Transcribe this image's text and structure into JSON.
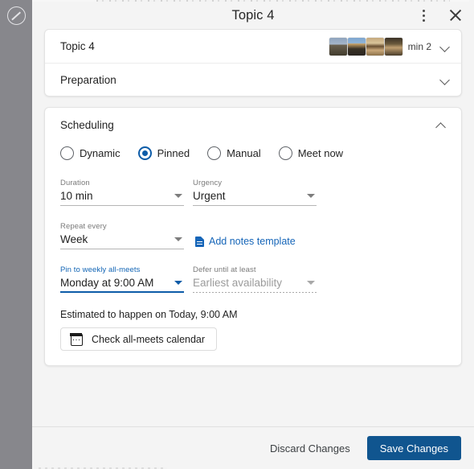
{
  "rail": {
    "icon": "edit-circle-icon"
  },
  "dialog": {
    "title": "Topic 4",
    "menu_icon": "kebab-menu-icon",
    "close_icon": "close-icon"
  },
  "topics": {
    "rows": [
      {
        "label": "Topic 4",
        "meta": "min 2",
        "chevron": "chevron-down-icon",
        "has_avatars": true
      },
      {
        "label": "Preparation",
        "meta": "",
        "chevron": "chevron-down-icon",
        "has_avatars": false
      }
    ]
  },
  "scheduling": {
    "title": "Scheduling",
    "collapse_icon": "chevron-up-icon",
    "modes": [
      {
        "label": "Dynamic",
        "selected": false
      },
      {
        "label": "Pinned",
        "selected": true
      },
      {
        "label": "Manual",
        "selected": false
      },
      {
        "label": "Meet now",
        "selected": false
      }
    ],
    "duration": {
      "label": "Duration",
      "value": "10 min"
    },
    "urgency": {
      "label": "Urgency",
      "value": "Urgent"
    },
    "repeat": {
      "label": "Repeat every",
      "value": "Week"
    },
    "notes_link": {
      "label": "Add notes template",
      "icon": "note-document-icon"
    },
    "pin": {
      "label": "Pin to weekly all-meets",
      "value": "Monday at 9:00 AM"
    },
    "defer": {
      "label": "Defer until at least",
      "value": "Earliest availability"
    },
    "estimate_text": "Estimated to happen on Today, 9:00 AM",
    "calendar_button": {
      "label": "Check all-meets calendar",
      "icon": "calendar-icon"
    }
  },
  "footer": {
    "discard_label": "Discard Changes",
    "save_label": "Save Changes"
  },
  "colors": {
    "accent_blue": "#0d5ca8",
    "save_blue": "#10558f",
    "link_blue": "#1565b8",
    "rail_gray": "#87878c"
  }
}
